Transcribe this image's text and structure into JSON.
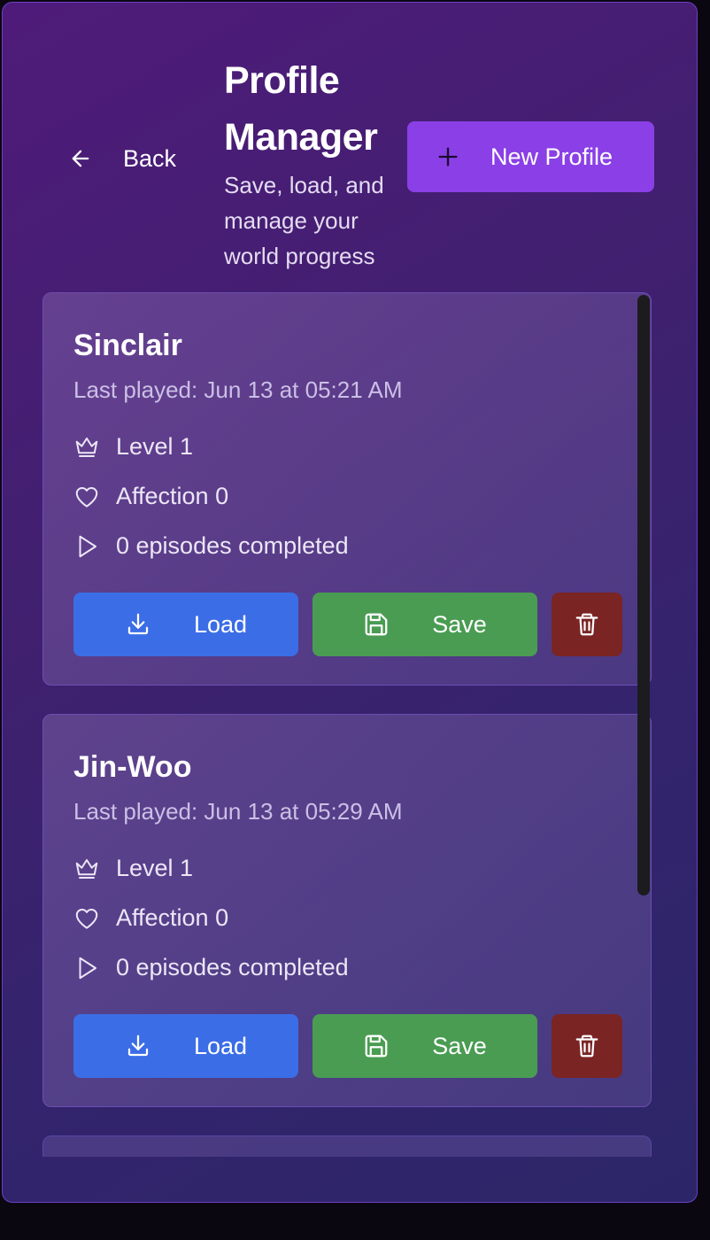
{
  "header": {
    "back_label": "Back",
    "title": "Profile Manager",
    "subtitle": "Save, load, and manage your world progress",
    "new_profile_label": "New Profile"
  },
  "profiles": [
    {
      "name": "Sinclair",
      "last_played": "Last played: Jun 13 at 05:21 AM",
      "level": "Level 1",
      "affection": "Affection 0",
      "episodes": "0 episodes completed",
      "load_label": "Load",
      "save_label": "Save"
    },
    {
      "name": "Jin-Woo",
      "last_played": "Last played: Jun 13 at 05:29 AM",
      "level": "Level 1",
      "affection": "Affection 0",
      "episodes": "0 episodes completed",
      "load_label": "Load",
      "save_label": "Save"
    }
  ],
  "colors": {
    "accent": "#8b3fe6",
    "load": "#3b6de6",
    "save": "#4a9c52",
    "delete": "#7a2424"
  },
  "icons": [
    "arrow-left-icon",
    "plus-icon",
    "crown-icon",
    "heart-icon",
    "play-icon",
    "download-icon",
    "floppy-disk-icon",
    "trash-icon"
  ]
}
